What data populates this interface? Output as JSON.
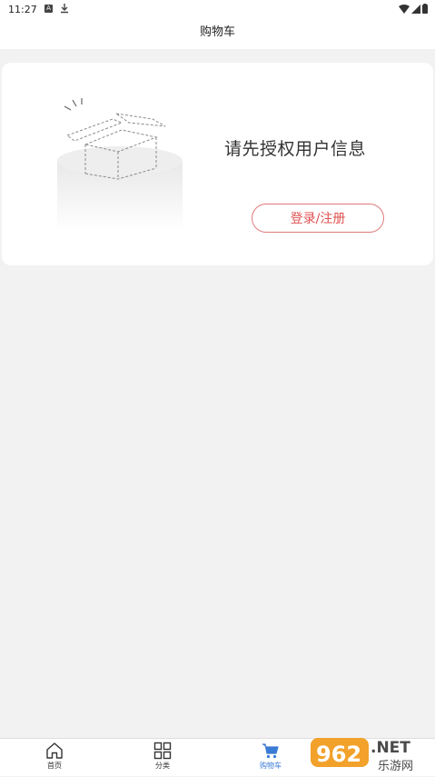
{
  "status_bar": {
    "time": "11:27",
    "icons": [
      "a-badge-icon",
      "download-icon",
      "wifi-icon",
      "signal-icon",
      "battery-icon"
    ]
  },
  "header": {
    "title": "购物车"
  },
  "empty_state": {
    "message": "请先授权用户信息",
    "login_button": "登录/注册",
    "accent_color": "#e05050"
  },
  "tabbar": {
    "tabs": [
      {
        "label": "首页",
        "icon": "home-icon",
        "active": false
      },
      {
        "label": "分类",
        "icon": "grid-icon",
        "active": false
      },
      {
        "label": "购物车",
        "icon": "cart-icon",
        "active": true
      }
    ],
    "active_color": "#3a7bd5"
  },
  "watermark": {
    "brand": "962",
    "suffix": ".NET",
    "subtitle": "乐游网"
  }
}
